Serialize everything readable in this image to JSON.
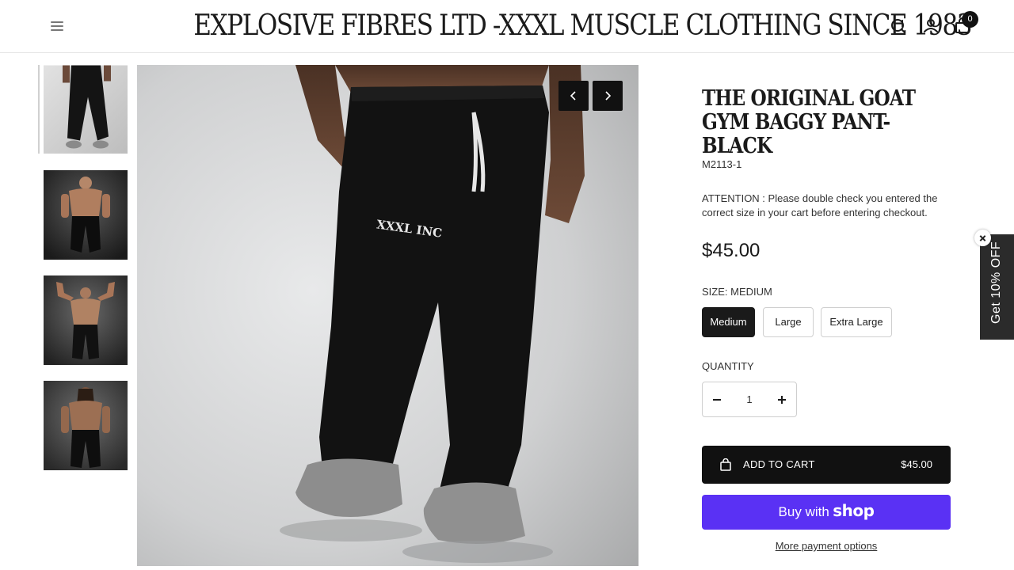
{
  "header": {
    "brand": "EXPLOSIVE FIBRES LTD -XXXL MUSCLE CLOTHING SINCE 1983",
    "cart_count": "0",
    "icons": [
      "menu-icon",
      "search-icon",
      "account-icon",
      "cart-icon"
    ]
  },
  "gallery": {
    "thumbnails": 4,
    "active_index": 0,
    "main_image_text": "XXXL INC"
  },
  "product": {
    "title": "THE ORIGINAL GOAT GYM BAGGY PANT-BLACK",
    "sku": "M2113-1",
    "attention": "ATTENTION : Please double check you entered the correct size in your cart before entering checkout.",
    "price": "$45.00",
    "size_label": "SIZE: MEDIUM",
    "sizes": [
      "Medium",
      "Large",
      "Extra Large"
    ],
    "selected_size": "Medium",
    "quantity_label": "QUANTITY",
    "quantity": "1",
    "add_to_cart_label": "ADD TO CART",
    "add_to_cart_price": "$45.00",
    "buy_with_label": "Buy with",
    "shop_pay_logo": "shop",
    "more_payment_label": "More payment options"
  },
  "promo": {
    "label": "Get 10% OFF"
  },
  "colors": {
    "primary": "#111111",
    "shop_pay": "#5a31f4",
    "promo_tab": "#2b2b2b"
  }
}
